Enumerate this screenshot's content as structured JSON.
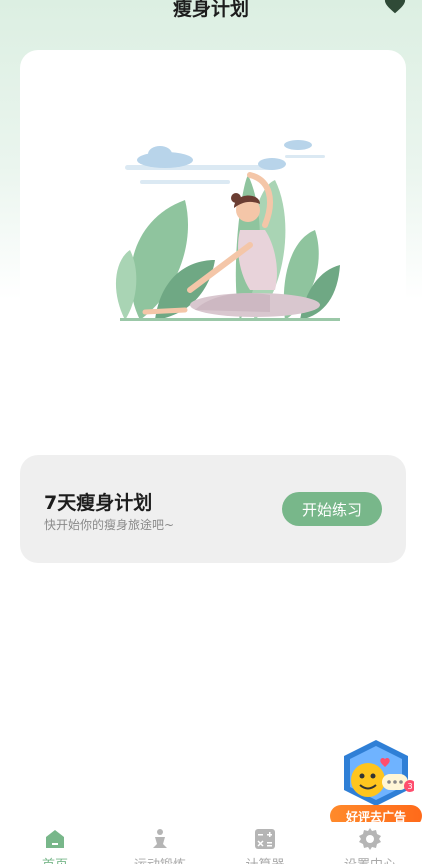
{
  "header": {
    "title": "瘦身计划",
    "favorite_icon": "heart-icon"
  },
  "hero": {
    "illustration": "yoga-woman-stretching-among-leaves"
  },
  "plan": {
    "title": "7天瘦身计划",
    "subtitle": "快开始你的瘦身旅途吧~",
    "start_label": "开始练习"
  },
  "ad": {
    "label": "好评去广告",
    "badge_count": "3"
  },
  "tabs": [
    {
      "label": "首页",
      "icon": "home-icon",
      "active": true
    },
    {
      "label": "运动锻炼",
      "icon": "exercise-icon",
      "active": false
    },
    {
      "label": "计算器",
      "icon": "calculator-icon",
      "active": false
    },
    {
      "label": "设置中心",
      "icon": "gear-icon",
      "active": false
    }
  ],
  "colors": {
    "accent": "#78b78a",
    "header_bg": "#dcefe2",
    "card_bg": "#efefef",
    "ad_orange": "#ff7a22"
  }
}
